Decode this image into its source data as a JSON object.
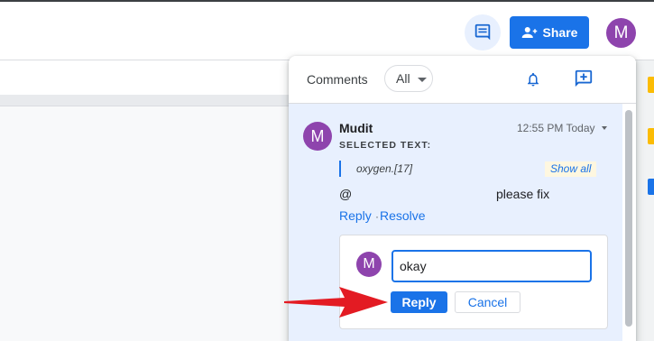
{
  "header": {
    "share_label": "Share",
    "avatar_letter": "M",
    "comments_icon": "comment-icon",
    "share_icon": "person-add-icon"
  },
  "comments_panel": {
    "title": "Comments",
    "filter_value": "All",
    "bell_icon": "bell-icon",
    "add_icon": "add-comment-icon"
  },
  "comment": {
    "avatar_letter": "M",
    "author": "Mudit",
    "time": "12:55 PM Today",
    "selected_label": "SELECTED TEXT:",
    "quote": "oxygen.[17]",
    "show_all": "Show all",
    "body_mention": "@",
    "body_text": "please fix",
    "reply_link": "Reply",
    "resolve_link": "Resolve"
  },
  "reply": {
    "avatar_letter": "M",
    "input_value": "okay",
    "reply_button": "Reply",
    "cancel_button": "Cancel"
  },
  "colors": {
    "accent": "#1a73e8",
    "avatar": "#8e44ad",
    "thread_bg": "#e8f0fe",
    "arrow": "#e31b23"
  }
}
